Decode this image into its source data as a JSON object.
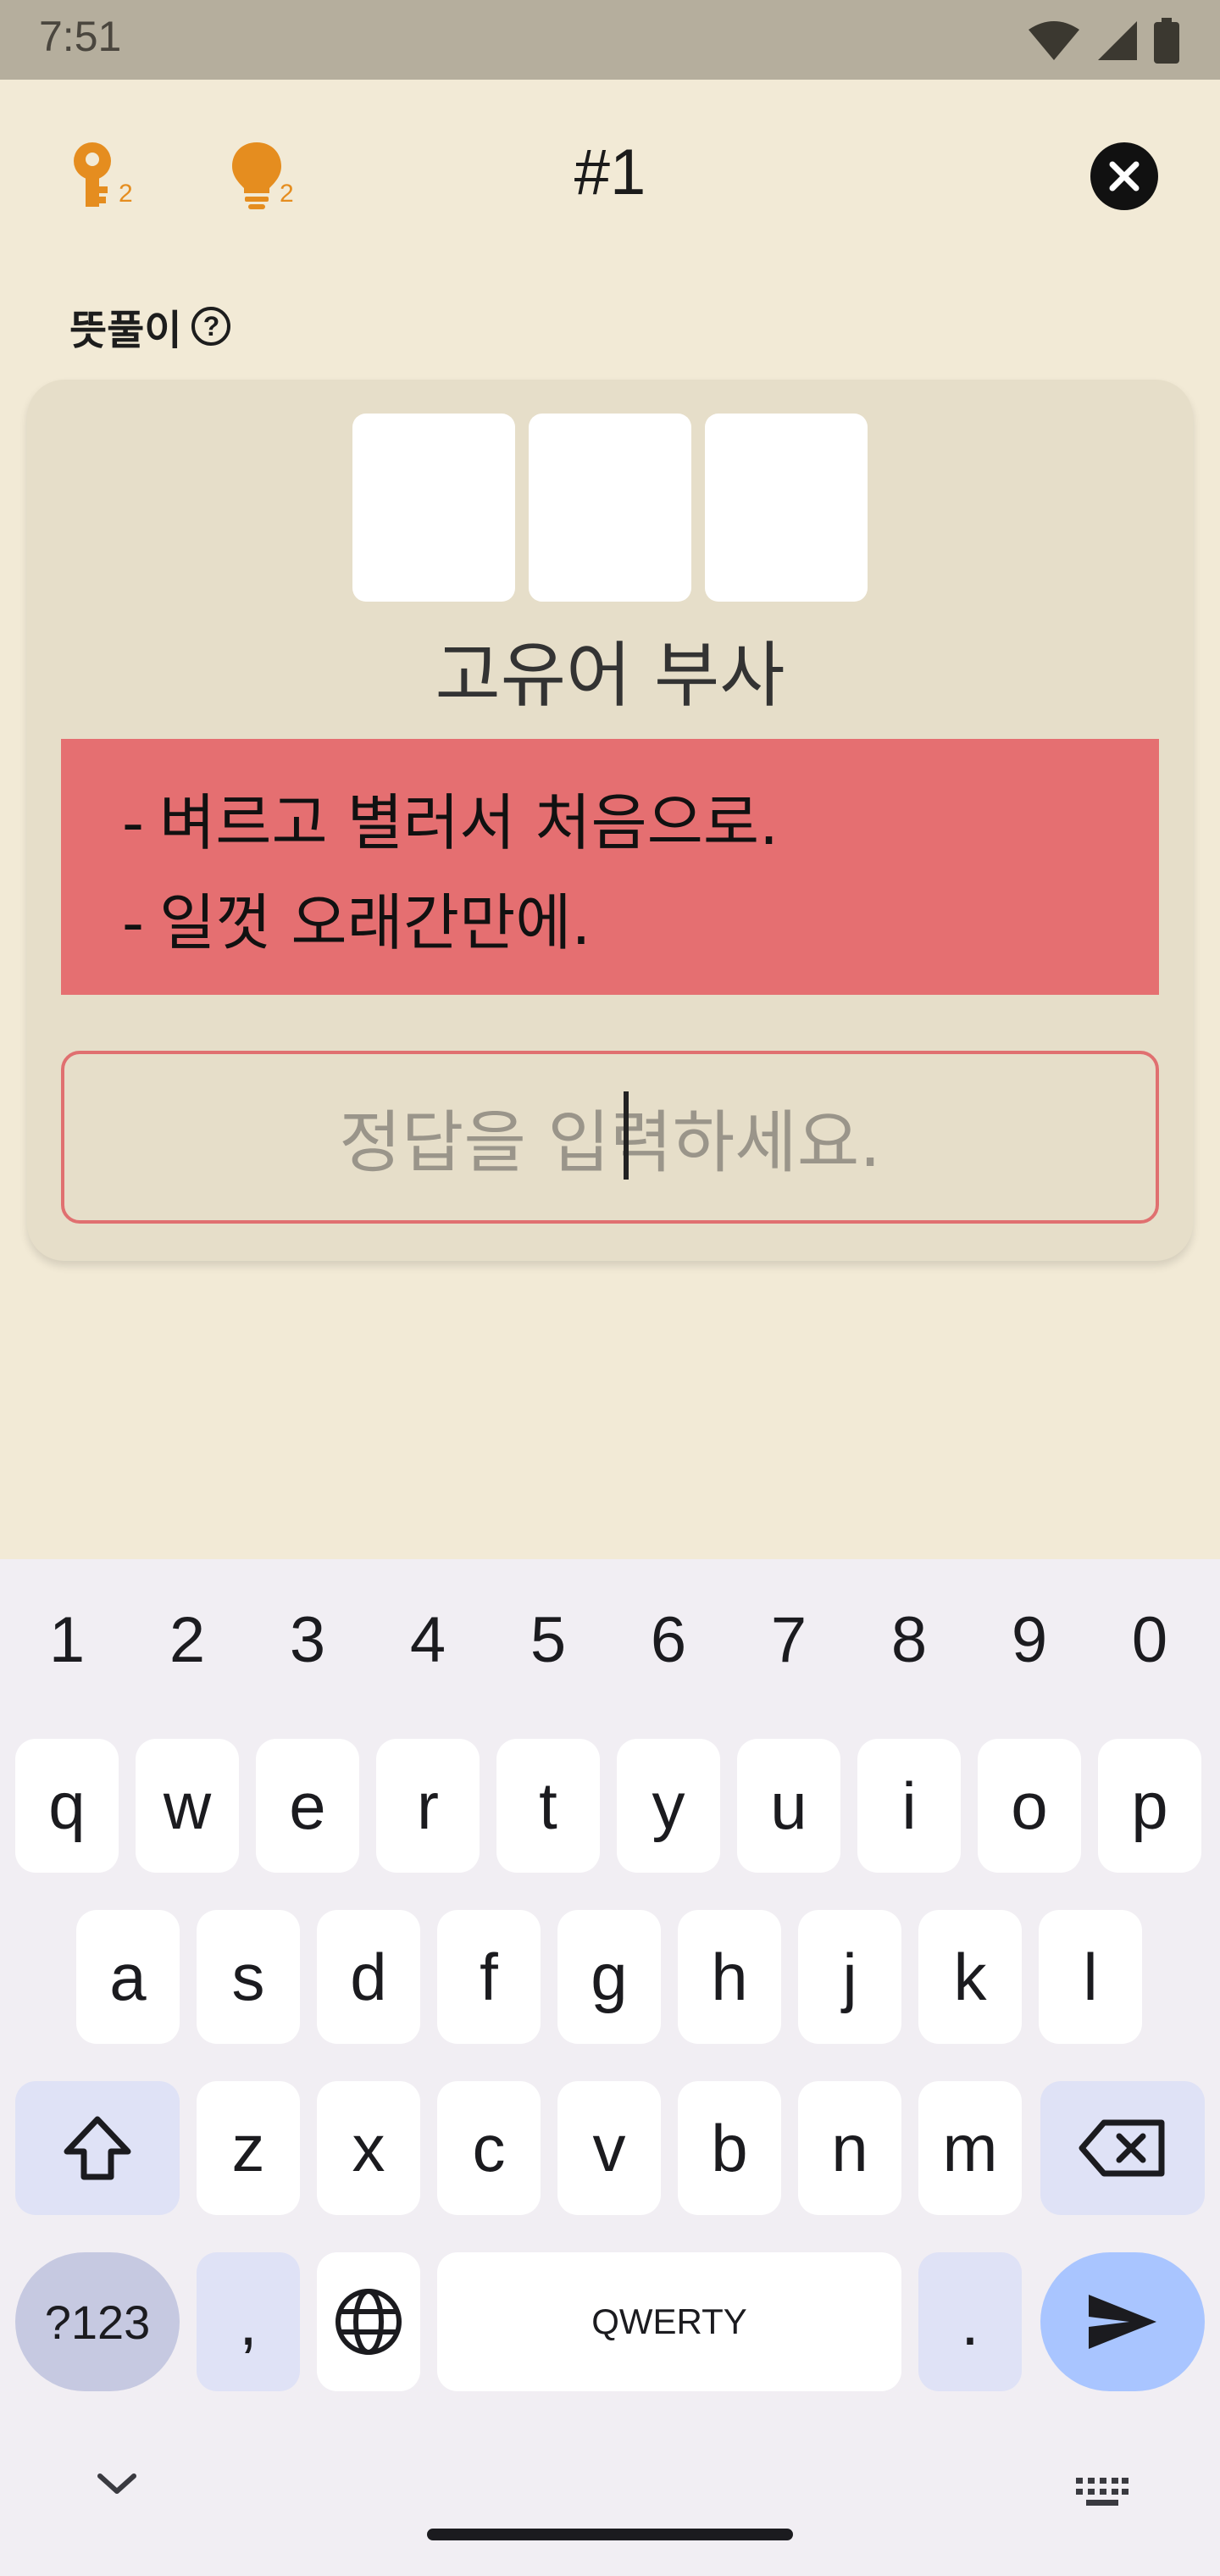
{
  "status_bar": {
    "time": "7:51"
  },
  "header": {
    "key_count": "2",
    "hint_count": "2",
    "puzzle_number": "#1"
  },
  "section": {
    "label": "뜻풀이",
    "help": "?"
  },
  "card": {
    "word_class": "고유어 부사",
    "definitions": [
      "벼르고 별러서 처음으로.",
      "일껏 오래간만에."
    ],
    "answer_placeholder": "정답을 입력하세요."
  },
  "keyboard": {
    "numbers": [
      "1",
      "2",
      "3",
      "4",
      "5",
      "6",
      "7",
      "8",
      "9",
      "0"
    ],
    "row1": [
      "q",
      "w",
      "e",
      "r",
      "t",
      "y",
      "u",
      "i",
      "o",
      "p"
    ],
    "row2": [
      "a",
      "s",
      "d",
      "f",
      "g",
      "h",
      "j",
      "k",
      "l"
    ],
    "row3": [
      "z",
      "x",
      "c",
      "v",
      "b",
      "n",
      "m"
    ],
    "symbols_label": "?123",
    "comma": ",",
    "space_label": "QWERTY",
    "period": "."
  },
  "colors": {
    "background": "#f2ead6",
    "card": "#e6dec9",
    "definition_bg": "#e56f71",
    "accent_orange": "#e58d1f",
    "input_border": "#e07070"
  }
}
